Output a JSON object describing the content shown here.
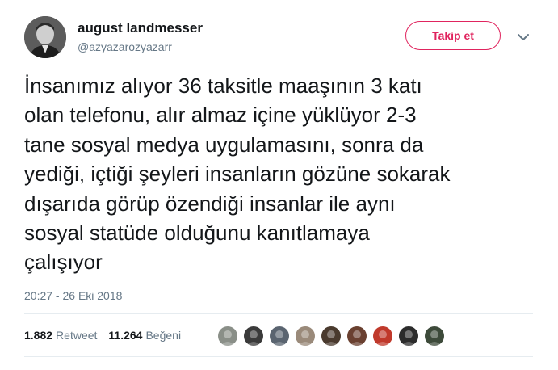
{
  "author": {
    "display_name": "august landmesser",
    "handle": "@azyazarozyazarr",
    "avatar_icon": "profile-photo"
  },
  "follow_button": {
    "label": "Takip et",
    "color": "#e0245e"
  },
  "menu_icon": "chevron-down-icon",
  "tweet": {
    "text": "İnsanımız alıyor 36 taksitle maaşının 3 katı\nolan telefonu, alır almaz içine yüklüyor 2-3\ntane sosyal medya uygulamasını, sonra da\nyediği, içtiği şeyleri insanların gözüne sokarak\ndışarıda görüp özendiği insanlar ile aynı\nsosyal statüde olduğunu kanıtlamaya\nçalışıyor",
    "timestamp": "20:27 - 26 Eki 2018"
  },
  "stats": {
    "retweets_count": "1.882",
    "retweets_label": "Retweet",
    "likes_count": "11.264",
    "likes_label": "Beğeni"
  },
  "likers": [
    {
      "name": "liker-1",
      "color": "#8a8f88"
    },
    {
      "name": "liker-2",
      "color": "#3a3a3a"
    },
    {
      "name": "liker-3",
      "color": "#5a6470"
    },
    {
      "name": "liker-4",
      "color": "#9a8a7a"
    },
    {
      "name": "liker-5",
      "color": "#4a3a2e"
    },
    {
      "name": "liker-6",
      "color": "#6a4030"
    },
    {
      "name": "liker-7",
      "color": "#c0392b"
    },
    {
      "name": "liker-8",
      "color": "#2c2c2c"
    },
    {
      "name": "liker-9",
      "color": "#3d4a3a"
    }
  ]
}
